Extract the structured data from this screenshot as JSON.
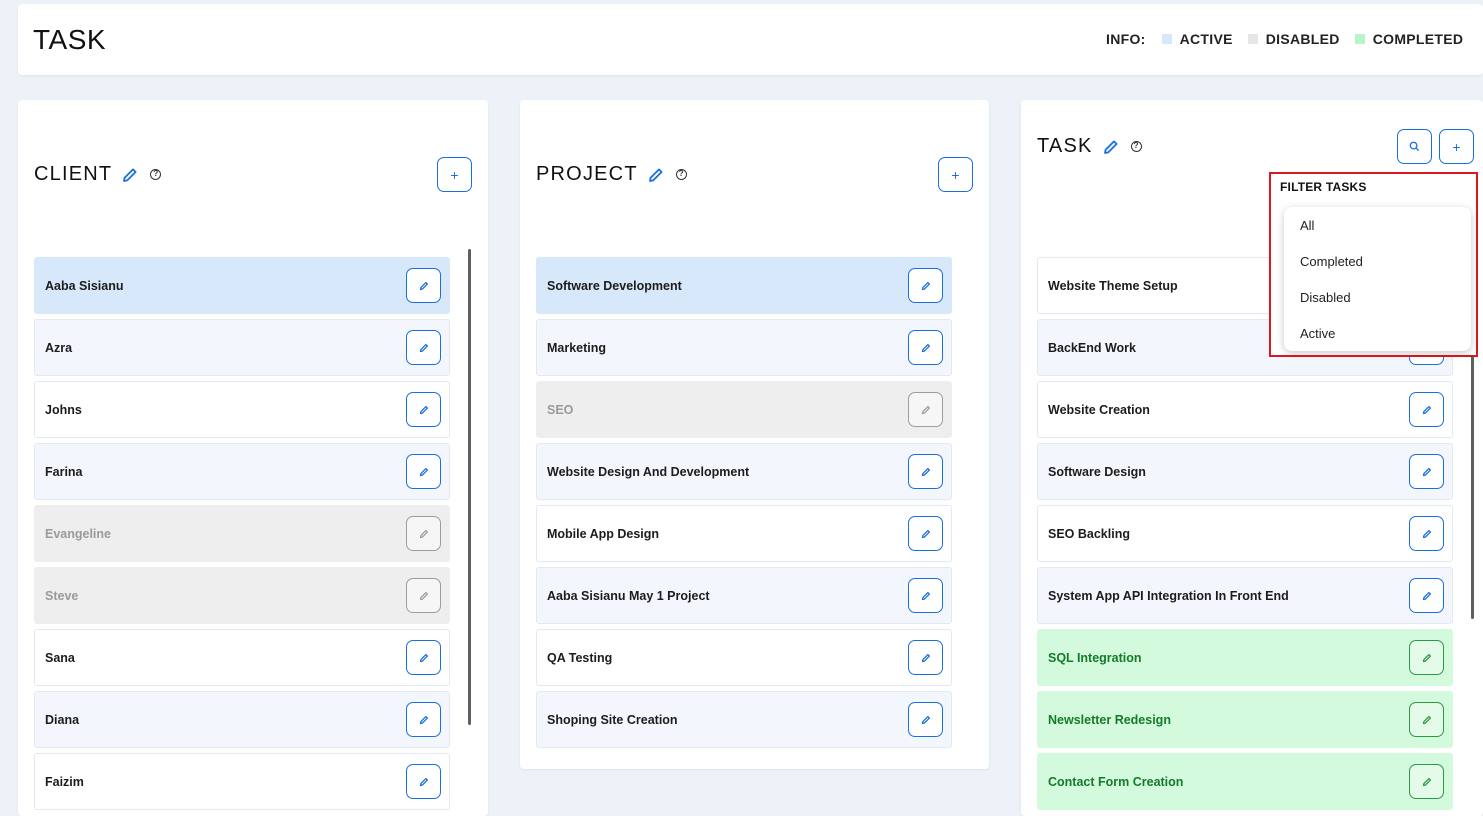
{
  "header": {
    "title": "TASK",
    "info_label": "INFO:",
    "legend": [
      {
        "label": "ACTIVE",
        "color": "#d7e8fb"
      },
      {
        "label": "DISABLED",
        "color": "#e6e6e6"
      },
      {
        "label": "COMPLETED",
        "color": "#b8f5c6"
      }
    ]
  },
  "client": {
    "title": "CLIENT",
    "add_label": "+",
    "items": [
      {
        "name": "Aaba Sisianu",
        "state": "selected"
      },
      {
        "name": "Azra",
        "state": "active"
      },
      {
        "name": "Johns",
        "state": "active"
      },
      {
        "name": "Farina",
        "state": "active"
      },
      {
        "name": "Evangeline",
        "state": "disabled"
      },
      {
        "name": "Steve",
        "state": "disabled"
      },
      {
        "name": "Sana",
        "state": "active"
      },
      {
        "name": "Diana",
        "state": "active"
      },
      {
        "name": "Faizim",
        "state": "active"
      }
    ]
  },
  "project": {
    "title": "PROJECT",
    "add_label": "+",
    "items": [
      {
        "name": "Software Development",
        "state": "selected"
      },
      {
        "name": "Marketing",
        "state": "active"
      },
      {
        "name": "SEO",
        "state": "disabled"
      },
      {
        "name": "Website Design And Development",
        "state": "active"
      },
      {
        "name": "Mobile App Design",
        "state": "active"
      },
      {
        "name": "Aaba Sisianu May 1 Project",
        "state": "active"
      },
      {
        "name": "QA Testing",
        "state": "active"
      },
      {
        "name": "Shoping Site Creation",
        "state": "active"
      }
    ]
  },
  "task": {
    "title": "TASK",
    "add_label": "+",
    "items": [
      {
        "name": "Website Theme Setup",
        "state": "active"
      },
      {
        "name": "BackEnd Work",
        "state": "active"
      },
      {
        "name": "Website Creation",
        "state": "active"
      },
      {
        "name": "Software Design",
        "state": "active"
      },
      {
        "name": "SEO Backling",
        "state": "active"
      },
      {
        "name": "System App API Integration In Front End",
        "state": "active"
      },
      {
        "name": "SQL Integration",
        "state": "completed"
      },
      {
        "name": "Newsletter Redesign",
        "state": "completed"
      },
      {
        "name": "Contact Form Creation",
        "state": "completed"
      }
    ]
  },
  "filter": {
    "title": "FILTER TASKS",
    "options": [
      "All",
      "Completed",
      "Disabled",
      "Active"
    ]
  },
  "icons": {
    "edit": "pencil-icon",
    "help": "help-circle-icon",
    "search": "search-icon",
    "add": "plus-icon"
  }
}
